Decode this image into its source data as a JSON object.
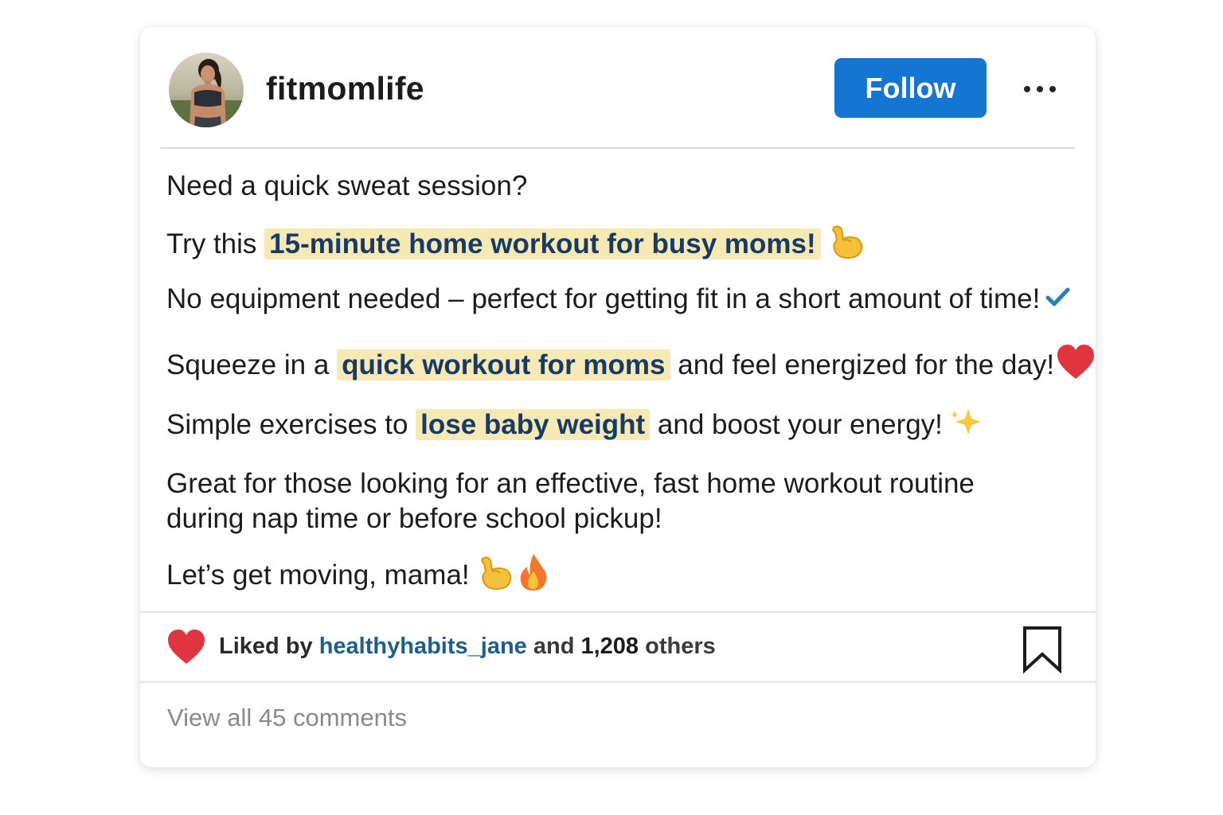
{
  "post": {
    "username": "fitmomlife",
    "follow_label": "Follow",
    "more_icon": "more-dots-icon"
  },
  "caption": {
    "line1": "Need a quick sweat session?",
    "line2_pre": "Try this ",
    "line2_hl": "15-minute home workout for busy moms!",
    "line3": "No equipment needed – perfect for getting fit in a short amount of time!",
    "line4_pre": "Squeeze in a ",
    "line4_hl": "quick workout for moms",
    "line4_post": " and feel energized for the day!",
    "line5_pre": "Simple exercises to ",
    "line5_hl": "lose baby weight",
    "line5_post": " and boost your energy!",
    "line6a": "Great for those looking for an effective, fast home workout routine",
    "line6b": "during nap time or before school pickup!",
    "line7": "Let’s get moving, mama!"
  },
  "likes": {
    "prefix": "Liked by ",
    "user": "healthyhabits_jane",
    "middle": " and ",
    "count": "1,208",
    "suffix": " others"
  },
  "comments": {
    "view_all": "View all 45 comments"
  },
  "colors": {
    "follow_button": "#1476d2",
    "highlight": "#f6e9b3",
    "highlight_text": "#173a66",
    "like_heart": "#e0343f",
    "username_link": "#1d5f8c"
  }
}
